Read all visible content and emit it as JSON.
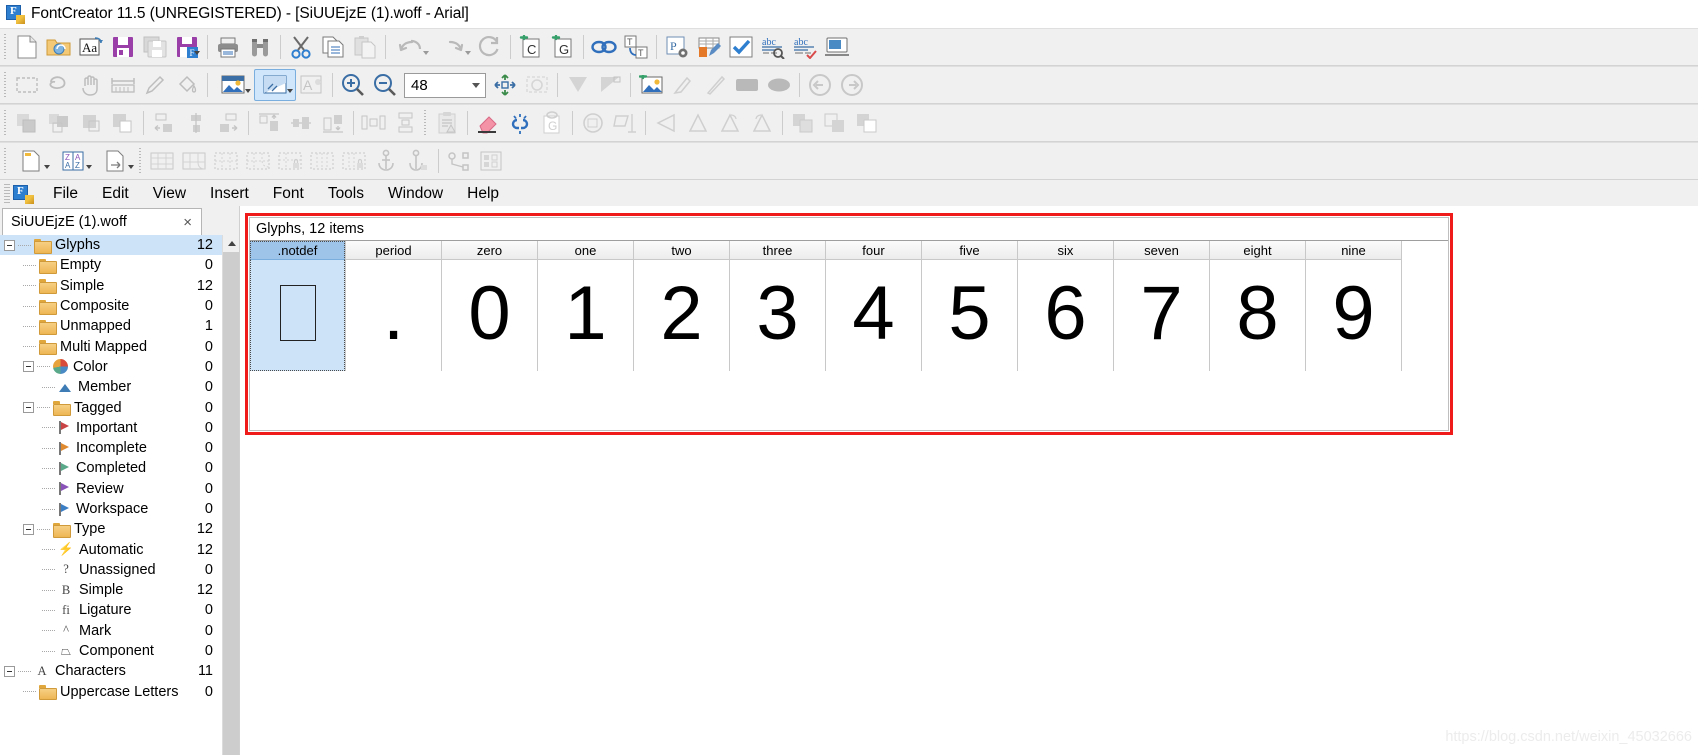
{
  "window": {
    "title": "FontCreator 11.5 (UNREGISTERED) - [SiUUEjzE (1).woff - Arial]",
    "app_icon": "fontcreator-icon"
  },
  "toolbars": {
    "row1": [
      {
        "name": "new-document-button",
        "icon": "new-page-icon",
        "enabled": true
      },
      {
        "name": "open-font-button",
        "icon": "open-folder-icon",
        "enabled": true
      },
      {
        "name": "install-font-button",
        "icon": "font-aa-icon",
        "enabled": true
      },
      {
        "name": "save-button",
        "icon": "save-floppy-icon",
        "enabled": true
      },
      {
        "name": "save-all-button",
        "icon": "save-all-icon",
        "enabled": false
      },
      {
        "name": "save-as-button",
        "icon": "save-as-icon",
        "enabled": true,
        "has_dropdown": true
      },
      {
        "name": "print-button",
        "icon": "printer-icon",
        "enabled": true
      },
      {
        "name": "find-button",
        "icon": "binoculars-icon",
        "enabled": true
      },
      {
        "name": "cut-button",
        "icon": "scissors-icon",
        "enabled": true
      },
      {
        "name": "copy-button",
        "icon": "copy-icon",
        "enabled": true
      },
      {
        "name": "paste-button",
        "icon": "paste-icon",
        "enabled": false
      },
      {
        "name": "undo-button",
        "icon": "undo-arrow-icon",
        "enabled": false,
        "has_dropdown": true
      },
      {
        "name": "redo-button",
        "icon": "redo-arrow-icon",
        "enabled": false,
        "has_dropdown": true
      },
      {
        "name": "refresh-button",
        "icon": "refresh-circle-icon",
        "enabled": false
      },
      {
        "name": "add-character-button",
        "icon": "add-c-icon",
        "enabled": true
      },
      {
        "name": "add-glyph-button",
        "icon": "add-g-icon",
        "enabled": true
      },
      {
        "name": "link-glyph-button",
        "icon": "chain-link-icon",
        "enabled": true
      },
      {
        "name": "transform-text-button",
        "icon": "text-transform-icon",
        "enabled": true
      },
      {
        "name": "font-properties-button",
        "icon": "p-gear-icon",
        "enabled": true
      },
      {
        "name": "edit-table-button",
        "icon": "table-pencil-icon",
        "enabled": true
      },
      {
        "name": "validate-button",
        "icon": "checkmark-icon",
        "enabled": true
      },
      {
        "name": "test-preview-button",
        "icon": "abc-magnifier-icon",
        "enabled": true
      },
      {
        "name": "spellcheck-button",
        "icon": "abc-check-icon",
        "enabled": true
      },
      {
        "name": "preview-window-button",
        "icon": "monitor-icon",
        "enabled": true
      }
    ],
    "row2": [
      {
        "name": "marquee-select-tool",
        "icon": "dashed-rectangle-icon",
        "enabled": false
      },
      {
        "name": "lasso-select-tool",
        "icon": "lasso-icon",
        "enabled": false
      },
      {
        "name": "pan-tool",
        "icon": "hand-icon",
        "enabled": false
      },
      {
        "name": "measure-tool",
        "icon": "ruler-span-icon",
        "enabled": false
      },
      {
        "name": "pencil-tool",
        "icon": "pencil-icon",
        "enabled": false
      },
      {
        "name": "fill-tool",
        "icon": "paint-bucket-icon",
        "enabled": false
      },
      {
        "name": "image-background-button",
        "icon": "picture-icon",
        "enabled": true,
        "has_dropdown": true
      },
      {
        "name": "contour-view-button",
        "icon": "contour-view-icon",
        "enabled": true,
        "active": true,
        "has_dropdown": true
      },
      {
        "name": "glyph-overlay-button",
        "icon": "a-overlay-icon",
        "enabled": false
      },
      {
        "name": "zoom-in-button",
        "icon": "zoom-in-icon",
        "enabled": true
      },
      {
        "name": "zoom-out-button",
        "icon": "zoom-out-icon",
        "enabled": true
      },
      {
        "name": "zoom-level-combo",
        "icon": "combo-icon",
        "value": "48"
      },
      {
        "name": "fit-to-window-button",
        "icon": "fit-arrows-icon",
        "enabled": true
      },
      {
        "name": "zoom-selection-button",
        "icon": "zoom-selection-icon",
        "enabled": false
      },
      {
        "name": "left-sidebearing-button",
        "icon": "left-bearing-icon",
        "enabled": false
      },
      {
        "name": "right-sidebearing-button",
        "icon": "right-bearing-icon",
        "enabled": false
      },
      {
        "name": "insert-image-button",
        "icon": "add-picture-icon",
        "enabled": true
      },
      {
        "name": "brush-tool",
        "icon": "brush-icon",
        "enabled": false
      },
      {
        "name": "knife-tool",
        "icon": "knife-icon",
        "enabled": false
      },
      {
        "name": "rectangle-tool",
        "icon": "rectangle-shape-icon",
        "enabled": false
      },
      {
        "name": "ellipse-tool",
        "icon": "ellipse-shape-icon",
        "enabled": false
      },
      {
        "name": "previous-glyph-button",
        "icon": "left-arrow-circle-icon",
        "enabled": false
      },
      {
        "name": "next-glyph-button",
        "icon": "right-arrow-circle-icon",
        "enabled": false
      }
    ],
    "row3": [
      {
        "name": "bring-to-front-button",
        "icon": "bring-front-icon",
        "enabled": false
      },
      {
        "name": "bring-forward-button",
        "icon": "bring-forward-icon",
        "enabled": false
      },
      {
        "name": "send-backward-button",
        "icon": "send-backward-icon",
        "enabled": false
      },
      {
        "name": "send-to-back-button",
        "icon": "send-back-icon",
        "enabled": false
      },
      {
        "name": "align-left-button",
        "icon": "align-left-icon",
        "enabled": false
      },
      {
        "name": "align-center-button",
        "icon": "align-center-icon",
        "enabled": false
      },
      {
        "name": "align-right-button",
        "icon": "align-right-icon",
        "enabled": false
      },
      {
        "name": "align-top-button",
        "icon": "align-top-icon",
        "enabled": false
      },
      {
        "name": "align-middle-button",
        "icon": "align-middle-icon",
        "enabled": false
      },
      {
        "name": "align-bottom-button",
        "icon": "align-bottom-icon",
        "enabled": false
      },
      {
        "name": "distribute-horizontal-button",
        "icon": "distribute-h-icon",
        "enabled": false
      },
      {
        "name": "distribute-vertical-button",
        "icon": "distribute-v-icon",
        "enabled": false
      },
      {
        "name": "clipboard-warning-button",
        "icon": "clipboard-alert-icon",
        "enabled": false
      },
      {
        "name": "erase-button",
        "icon": "eraser-icon",
        "enabled": true
      },
      {
        "name": "unlink-button",
        "icon": "broken-chain-icon",
        "enabled": true
      },
      {
        "name": "link-to-glyph-button",
        "icon": "link-g-icon",
        "enabled": false
      },
      {
        "name": "rotate-button",
        "icon": "rotate-icon",
        "enabled": false
      },
      {
        "name": "skew-button",
        "icon": "skew-icon",
        "enabled": false
      },
      {
        "name": "flip-horizontal-button",
        "icon": "flip-h-icon",
        "enabled": false
      },
      {
        "name": "flip-vertical-button",
        "icon": "flip-v-icon",
        "enabled": false
      },
      {
        "name": "rotate-left-button",
        "icon": "rotate-left-icon",
        "enabled": false
      },
      {
        "name": "rotate-right-button",
        "icon": "rotate-right-icon",
        "enabled": false
      },
      {
        "name": "union-button",
        "icon": "union-shapes-icon",
        "enabled": false
      },
      {
        "name": "intersect-button",
        "icon": "intersect-shapes-icon",
        "enabled": false
      },
      {
        "name": "exclude-button",
        "icon": "exclude-shapes-icon",
        "enabled": false
      }
    ],
    "row4": [
      {
        "name": "new-glyph-button",
        "icon": "new-glyph-page-icon",
        "enabled": true,
        "has_dropdown": true
      },
      {
        "name": "sort-glyphs-button",
        "icon": "sort-az-icon",
        "enabled": true,
        "has_dropdown": true
      },
      {
        "name": "glyph-transform-button",
        "icon": "glyph-transform-icon",
        "enabled": true,
        "has_dropdown": true
      },
      {
        "name": "grid-view-button",
        "icon": "grid-full-icon",
        "enabled": false
      },
      {
        "name": "grid-wrap-button",
        "icon": "grid-wrap-icon",
        "enabled": false
      },
      {
        "name": "grid-rows-button",
        "icon": "grid-rows-icon",
        "enabled": false
      },
      {
        "name": "grid-rows-wrap-button",
        "icon": "grid-rows-wrap-icon",
        "enabled": false
      },
      {
        "name": "grid-lock-button",
        "icon": "grid-lock-icon",
        "enabled": false
      },
      {
        "name": "columns-button",
        "icon": "columns-icon",
        "enabled": false
      },
      {
        "name": "columns-lock-button",
        "icon": "columns-lock-icon",
        "enabled": false
      },
      {
        "name": "anchor-button",
        "icon": "anchor-icon",
        "enabled": false
      },
      {
        "name": "anchor-lock-button",
        "icon": "anchor-lock-icon",
        "enabled": false
      },
      {
        "name": "node-editor-button",
        "icon": "node-path-icon",
        "enabled": false
      },
      {
        "name": "metrics-button",
        "icon": "metrics-grid-icon",
        "enabled": false
      }
    ]
  },
  "menubar": {
    "items": [
      {
        "label": "File",
        "name": "menu-file"
      },
      {
        "label": "Edit",
        "name": "menu-edit"
      },
      {
        "label": "View",
        "name": "menu-view"
      },
      {
        "label": "Insert",
        "name": "menu-insert"
      },
      {
        "label": "Font",
        "name": "menu-font"
      },
      {
        "label": "Tools",
        "name": "menu-tools"
      },
      {
        "label": "Window",
        "name": "menu-window"
      },
      {
        "label": "Help",
        "name": "menu-help"
      }
    ]
  },
  "sidebar": {
    "tab": {
      "label": "SiUUEjzE (1).woff",
      "close": "×"
    },
    "tree": [
      {
        "label": "Glyphs",
        "count": "12",
        "indent": 0,
        "icon": "folder",
        "expander": true,
        "selected": true
      },
      {
        "label": "Empty",
        "count": "0",
        "indent": 1,
        "icon": "folder"
      },
      {
        "label": "Simple",
        "count": "12",
        "indent": 1,
        "icon": "folder"
      },
      {
        "label": "Composite",
        "count": "0",
        "indent": 1,
        "icon": "folder"
      },
      {
        "label": "Unmapped",
        "count": "1",
        "indent": 1,
        "icon": "folder"
      },
      {
        "label": "Multi Mapped",
        "count": "0",
        "indent": 1,
        "icon": "folder"
      },
      {
        "label": "Color",
        "count": "0",
        "indent": 1,
        "icon": "pie",
        "expander": true
      },
      {
        "label": "Member",
        "count": "0",
        "indent": 2,
        "icon": "triangle"
      },
      {
        "label": "Tagged",
        "count": "0",
        "indent": 1,
        "icon": "folder",
        "expander": true
      },
      {
        "label": "Important",
        "count": "0",
        "indent": 2,
        "icon": "flag",
        "color": "#c94545"
      },
      {
        "label": "Incomplete",
        "count": "0",
        "indent": 2,
        "icon": "flag",
        "color": "#e08a30"
      },
      {
        "label": "Completed",
        "count": "0",
        "indent": 2,
        "icon": "flag",
        "color": "#5aa98a"
      },
      {
        "label": "Review",
        "count": "0",
        "indent": 2,
        "icon": "flag",
        "color": "#8a53b8"
      },
      {
        "label": "Workspace",
        "count": "0",
        "indent": 2,
        "icon": "flag",
        "color": "#3c7ec4"
      },
      {
        "label": "Type",
        "count": "12",
        "indent": 1,
        "icon": "folder",
        "expander": true
      },
      {
        "label": "Automatic",
        "count": "12",
        "indent": 2,
        "icon": "glyph",
        "glyph": "⚡"
      },
      {
        "label": "Unassigned",
        "count": "0",
        "indent": 2,
        "icon": "glyph",
        "glyph": "?"
      },
      {
        "label": "Simple",
        "count": "12",
        "indent": 2,
        "icon": "glyph",
        "glyph": "B"
      },
      {
        "label": "Ligature",
        "count": "0",
        "indent": 2,
        "icon": "glyph",
        "glyph": "fi"
      },
      {
        "label": "Mark",
        "count": "0",
        "indent": 2,
        "icon": "glyph",
        "glyph": "^"
      },
      {
        "label": "Component",
        "count": "0",
        "indent": 2,
        "icon": "glyph",
        "glyph": "⏢"
      },
      {
        "label": "Characters",
        "count": "11",
        "indent": 0,
        "icon": "glyph",
        "glyph": "A",
        "expander": true
      },
      {
        "label": "Uppercase Letters",
        "count": "0",
        "indent": 1,
        "icon": "folder"
      }
    ]
  },
  "main": {
    "panel_header": "Glyphs, 12 items",
    "glyphs": [
      {
        "name": ".notdef",
        "render": "notdef",
        "selected": true
      },
      {
        "name": "period",
        "render": "."
      },
      {
        "name": "zero",
        "render": "0"
      },
      {
        "name": "one",
        "render": "1"
      },
      {
        "name": "two",
        "render": "2"
      },
      {
        "name": "three",
        "render": "3"
      },
      {
        "name": "four",
        "render": "4"
      },
      {
        "name": "five",
        "render": "5"
      },
      {
        "name": "six",
        "render": "6"
      },
      {
        "name": "seven",
        "render": "7"
      },
      {
        "name": "eight",
        "render": "8"
      },
      {
        "name": "nine",
        "render": "9"
      }
    ],
    "annotation_color": "#ef1b1b",
    "watermark": "https://blog.csdn.net/weixin_45032666"
  }
}
